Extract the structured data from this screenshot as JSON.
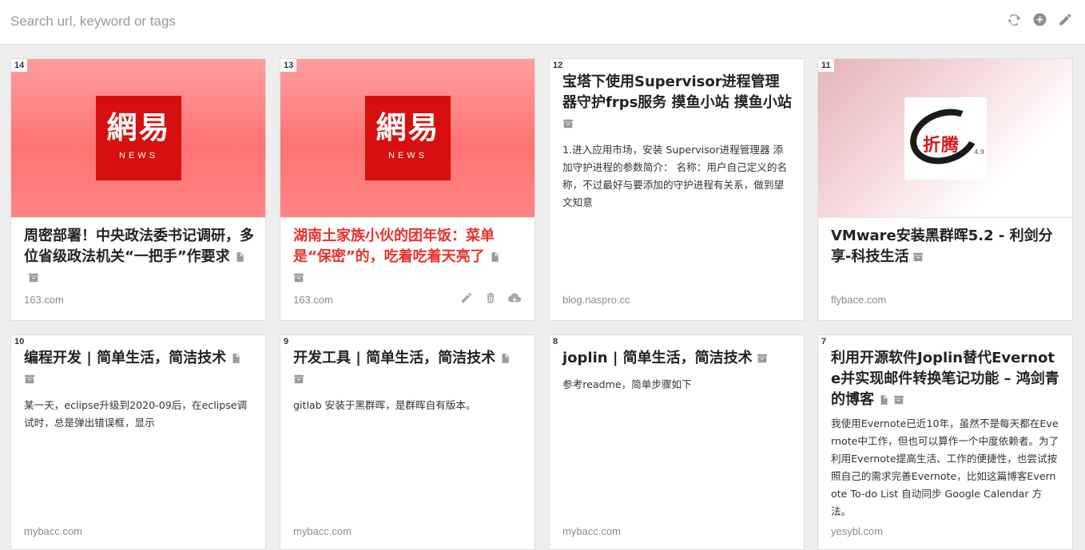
{
  "search": {
    "placeholder": "Search url, keyword or tags",
    "value": ""
  },
  "toolbar": {
    "refresh_icon": "refresh-icon",
    "add_icon": "add-circle-icon",
    "edit_icon": "pencil-icon"
  },
  "colors": {
    "accent_red": "#e8322c",
    "netease_red": "#d70f0f",
    "icon_gray": "#9a9a9a"
  },
  "cards": [
    {
      "index": "14",
      "title": "周密部署！中央政法委书记调研，多位省级政法机关“一把手”作要求",
      "description": "",
      "domain": "163.com",
      "logo_cn": "網易",
      "logo_en": "NEWS"
    },
    {
      "index": "13",
      "title": "湖南土家族小伙的团年饭：菜单是“保密”的，吃着吃着天亮了",
      "description": "",
      "domain": "163.com",
      "logo_cn": "網易",
      "logo_en": "NEWS"
    },
    {
      "index": "12",
      "title": "宝塔下使用Supervisor进程管理器守护frps服务 摸鱼小站 摸鱼小站",
      "description": "1.进入应用市场，安装 Supervisor进程管理器 添加守护进程的参数简介： 名称：用户自己定义的名称，不过最好与要添加的守护进程有关系，做到望文知意",
      "domain": "blog.naspro.cc"
    },
    {
      "index": "11",
      "title": "VMware安装黑群晖5.2 - 利剑分享-科技生活",
      "description": "",
      "domain": "flybace.com",
      "logo_text": "折腾",
      "logo_version": "4.9"
    },
    {
      "index": "10",
      "title": "编程开发 | 简单生活，简洁技术",
      "description": "某一天，eclipse升级到2020-09后，在eclipse调试时，总是弹出错误框，显示",
      "domain": "mybacc.com"
    },
    {
      "index": "9",
      "title": "开发工具 | 简单生活，简洁技术",
      "description": "gitlab 安装于黑群晖，是群晖自有版本。",
      "domain": "mybacc.com"
    },
    {
      "index": "8",
      "title": "joplin | 简单生活，简洁技术",
      "description": "参考readme，简单步骤如下",
      "domain": "mybacc.com"
    },
    {
      "index": "7",
      "title": "利用开源软件Joplin替代Evernote并实现邮件转换笔记功能 – 鸿剑青的博客",
      "description": "我使用Evernote已近10年，虽然不是每天都在Evernote中工作，但也可以算作一个中度依赖者。为了利用Evernote提高生活、工作的便捷性，也尝试按照自己的需求完善Evernote，比如这篇博客Evernote To-do List 自动同步 Google Calendar 方法。",
      "domain": "yesybl.com"
    }
  ]
}
